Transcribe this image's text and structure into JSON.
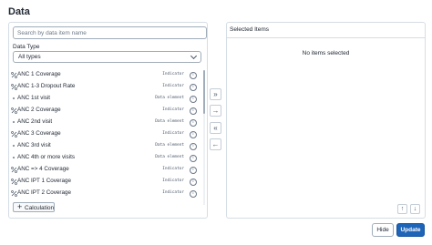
{
  "header": {
    "title": "Data"
  },
  "search": {
    "placeholder": "Search by data item name",
    "value": ""
  },
  "filter": {
    "label": "Data Type",
    "selected": "All types"
  },
  "items": [
    {
      "label": "ANC 1 Coverage",
      "type": "Indicator",
      "icon": "indicator-icon"
    },
    {
      "label": "ANC 1-3 Dropout Rate",
      "type": "Indicator",
      "icon": "indicator-icon"
    },
    {
      "label": "ANC 1st visit",
      "type": "Data element",
      "icon": "data-element-icon"
    },
    {
      "label": "ANC 2 Coverage",
      "type": "Indicator",
      "icon": "indicator-icon"
    },
    {
      "label": "ANC 2nd visit",
      "type": "Data element",
      "icon": "data-element-icon"
    },
    {
      "label": "ANC 3 Coverage",
      "type": "Indicator",
      "icon": "indicator-icon"
    },
    {
      "label": "ANC 3rd visit",
      "type": "Data element",
      "icon": "data-element-icon"
    },
    {
      "label": "ANC 4th or more visits",
      "type": "Data element",
      "icon": "data-element-icon"
    },
    {
      "label": "ANC => 4 Coverage",
      "type": "Indicator",
      "icon": "indicator-icon"
    },
    {
      "label": "ANC IPT 1 Coverage",
      "type": "Indicator",
      "icon": "indicator-icon"
    },
    {
      "label": "ANC IPT 2 Coverage",
      "type": "Indicator",
      "icon": "indicator-icon"
    }
  ],
  "calculation": {
    "label": "Calculation"
  },
  "transfer": {
    "select_all_icon": "double-chevron-right-icon",
    "select_one_icon": "chevron-right-icon",
    "deselect_all_icon": "double-chevron-left-icon",
    "deselect_one_icon": "chevron-left-icon"
  },
  "selected": {
    "title": "Selected Items",
    "empty_message": "No items selected"
  },
  "footer": {
    "hide_label": "Hide",
    "update_label": "Update"
  },
  "colors": {
    "primary": "#1e64b7",
    "border": "#d5dde5",
    "text": "#212934"
  }
}
